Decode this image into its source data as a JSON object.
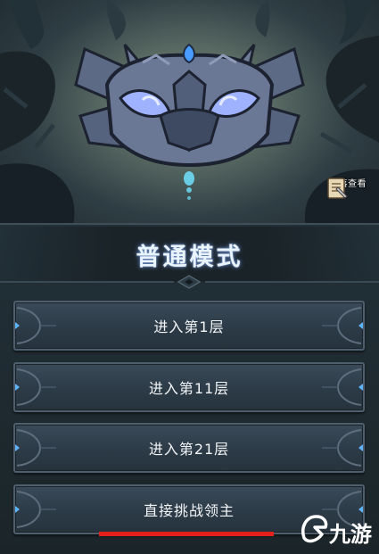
{
  "mode": {
    "title": "普通模式"
  },
  "drop": {
    "label": "掉落查看"
  },
  "buttons": [
    {
      "label": "进入第1层"
    },
    {
      "label": "进入第11层"
    },
    {
      "label": "进入第21层"
    },
    {
      "label": "直接挑战领主"
    }
  ],
  "watermark": {
    "text": "九游"
  },
  "colors": {
    "accent_blue": "#5fb4ff",
    "title_glow": "#5f7fb8",
    "red_bar": "#e5201c"
  }
}
